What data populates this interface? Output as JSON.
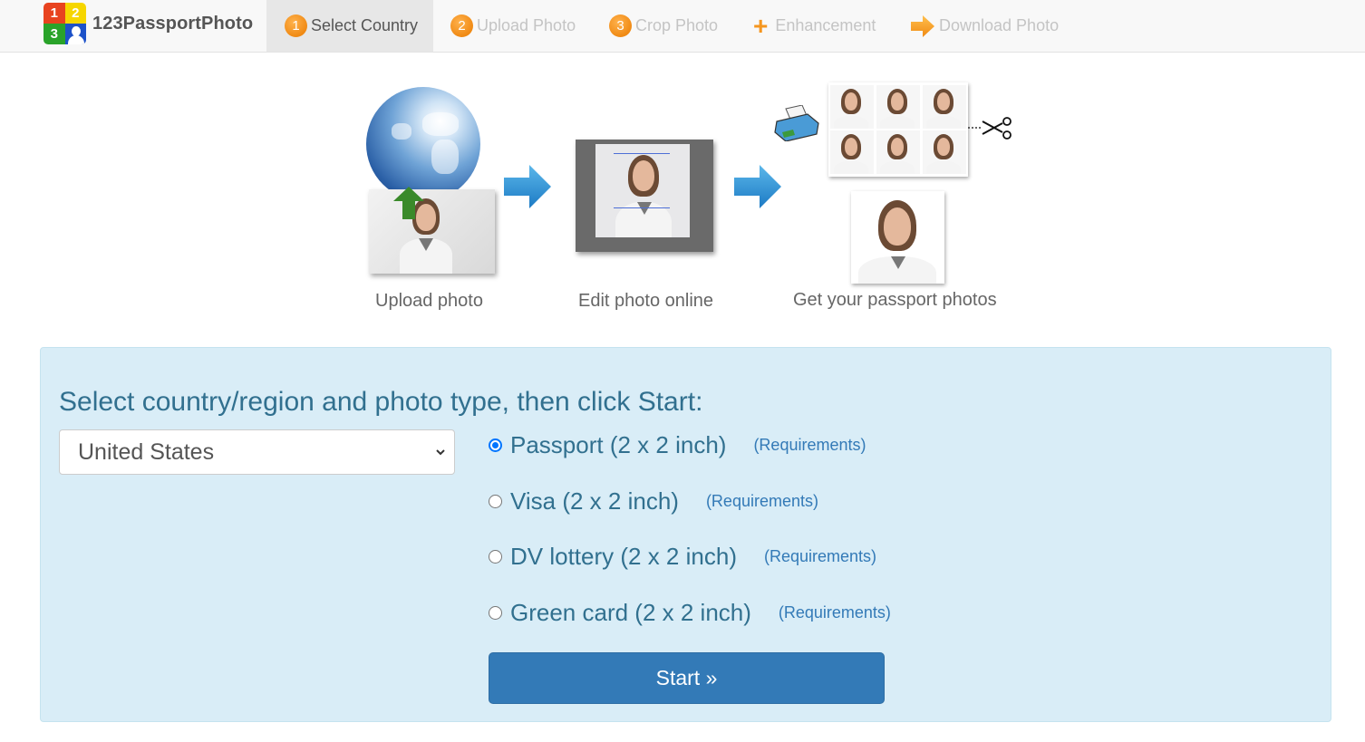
{
  "brand": {
    "logo_digits": [
      "1",
      "2",
      "3"
    ],
    "name": "123PassportPhoto",
    "colors": {
      "red": "#e8431f",
      "yellow": "#f6d600",
      "green": "#2aa32a",
      "blue": "#1d52c9"
    }
  },
  "nav": {
    "items": [
      {
        "badge": "1",
        "label": "Select Country",
        "active": true,
        "icon": "number-badge"
      },
      {
        "badge": "2",
        "label": "Upload Photo",
        "active": false,
        "icon": "number-badge"
      },
      {
        "badge": "3",
        "label": "Crop Photo",
        "active": false,
        "icon": "number-badge"
      },
      {
        "badge": "",
        "label": "Enhancement",
        "active": false,
        "icon": "plus-icon"
      },
      {
        "badge": "",
        "label": "Download Photo",
        "active": false,
        "icon": "arrow-right-icon"
      }
    ],
    "accent_color": "#f08a14"
  },
  "steps": [
    {
      "label": "Upload photo",
      "illustration": "globe-upload"
    },
    {
      "label": "Edit photo online",
      "illustration": "crop-editor"
    },
    {
      "label": "Get your passport photos",
      "illustration": "print-sheet"
    }
  ],
  "form": {
    "title": "Select country/region and photo type, then click Start:",
    "country": {
      "selected": "United States"
    },
    "photo_types": [
      {
        "label": "Passport (2 x 2 inch)",
        "link": "(Requirements)",
        "checked": true
      },
      {
        "label": "Visa (2 x 2 inch)",
        "link": "(Requirements)",
        "checked": false
      },
      {
        "label": "DV lottery (2 x 2 inch)",
        "link": "(Requirements)",
        "checked": false
      },
      {
        "label": "Green card (2 x 2 inch)",
        "link": "(Requirements)",
        "checked": false
      }
    ],
    "start_label": "Start »",
    "panel_color": "#d9edf7",
    "button_color": "#337ab7"
  }
}
